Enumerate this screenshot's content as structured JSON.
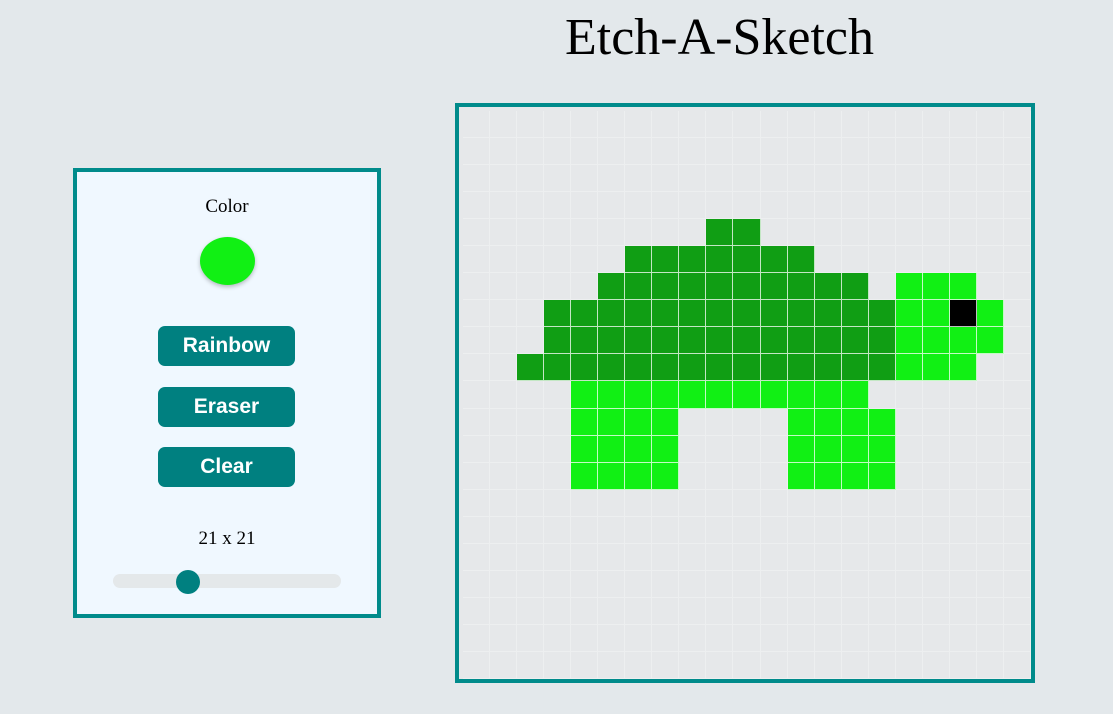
{
  "page": {
    "title": "Etch-A-Sketch"
  },
  "controls": {
    "color_label": "Color",
    "current_color": "#11f014",
    "rainbow_label": "Rainbow",
    "eraser_label": "Eraser",
    "clear_label": "Clear",
    "size_label": "21 x 21",
    "size_value": 21,
    "size_min": 2,
    "size_max": 64
  },
  "colors": {
    "accent": "#008080",
    "border": "#008b8b",
    "panel_bg": "#f0f8ff",
    "page_bg": "#e3e8eb",
    "cell_bg": "#e6e8ea",
    "dark_green": "#109e14",
    "light_green": "#11f014",
    "black": "#000000"
  },
  "board": {
    "size": 21,
    "legend": {
      "D": "dark_green",
      "L": "light_green",
      "K": "black",
      ".": "empty"
    },
    "rows": [
      ".....................",
      ".....................",
      ".....................",
      ".....................",
      ".........DD..........",
      "......DDDDDDD........",
      ".....DDDDDDDDDD.LLL..",
      "...DDDDDDDDDDDDDLLKL.",
      "...DDDDDDDDDDDDDLLLL.",
      "..DDDDDDDDDDDDDDLLL..",
      "....LLLLLLLLLLL......",
      "....LLLL....LLLL.....",
      "....LLLL....LLLL.....",
      "....LLLL....LLLL.....",
      ".....................",
      ".....................",
      ".....................",
      ".....................",
      ".....................",
      ".....................",
      "....................."
    ]
  }
}
